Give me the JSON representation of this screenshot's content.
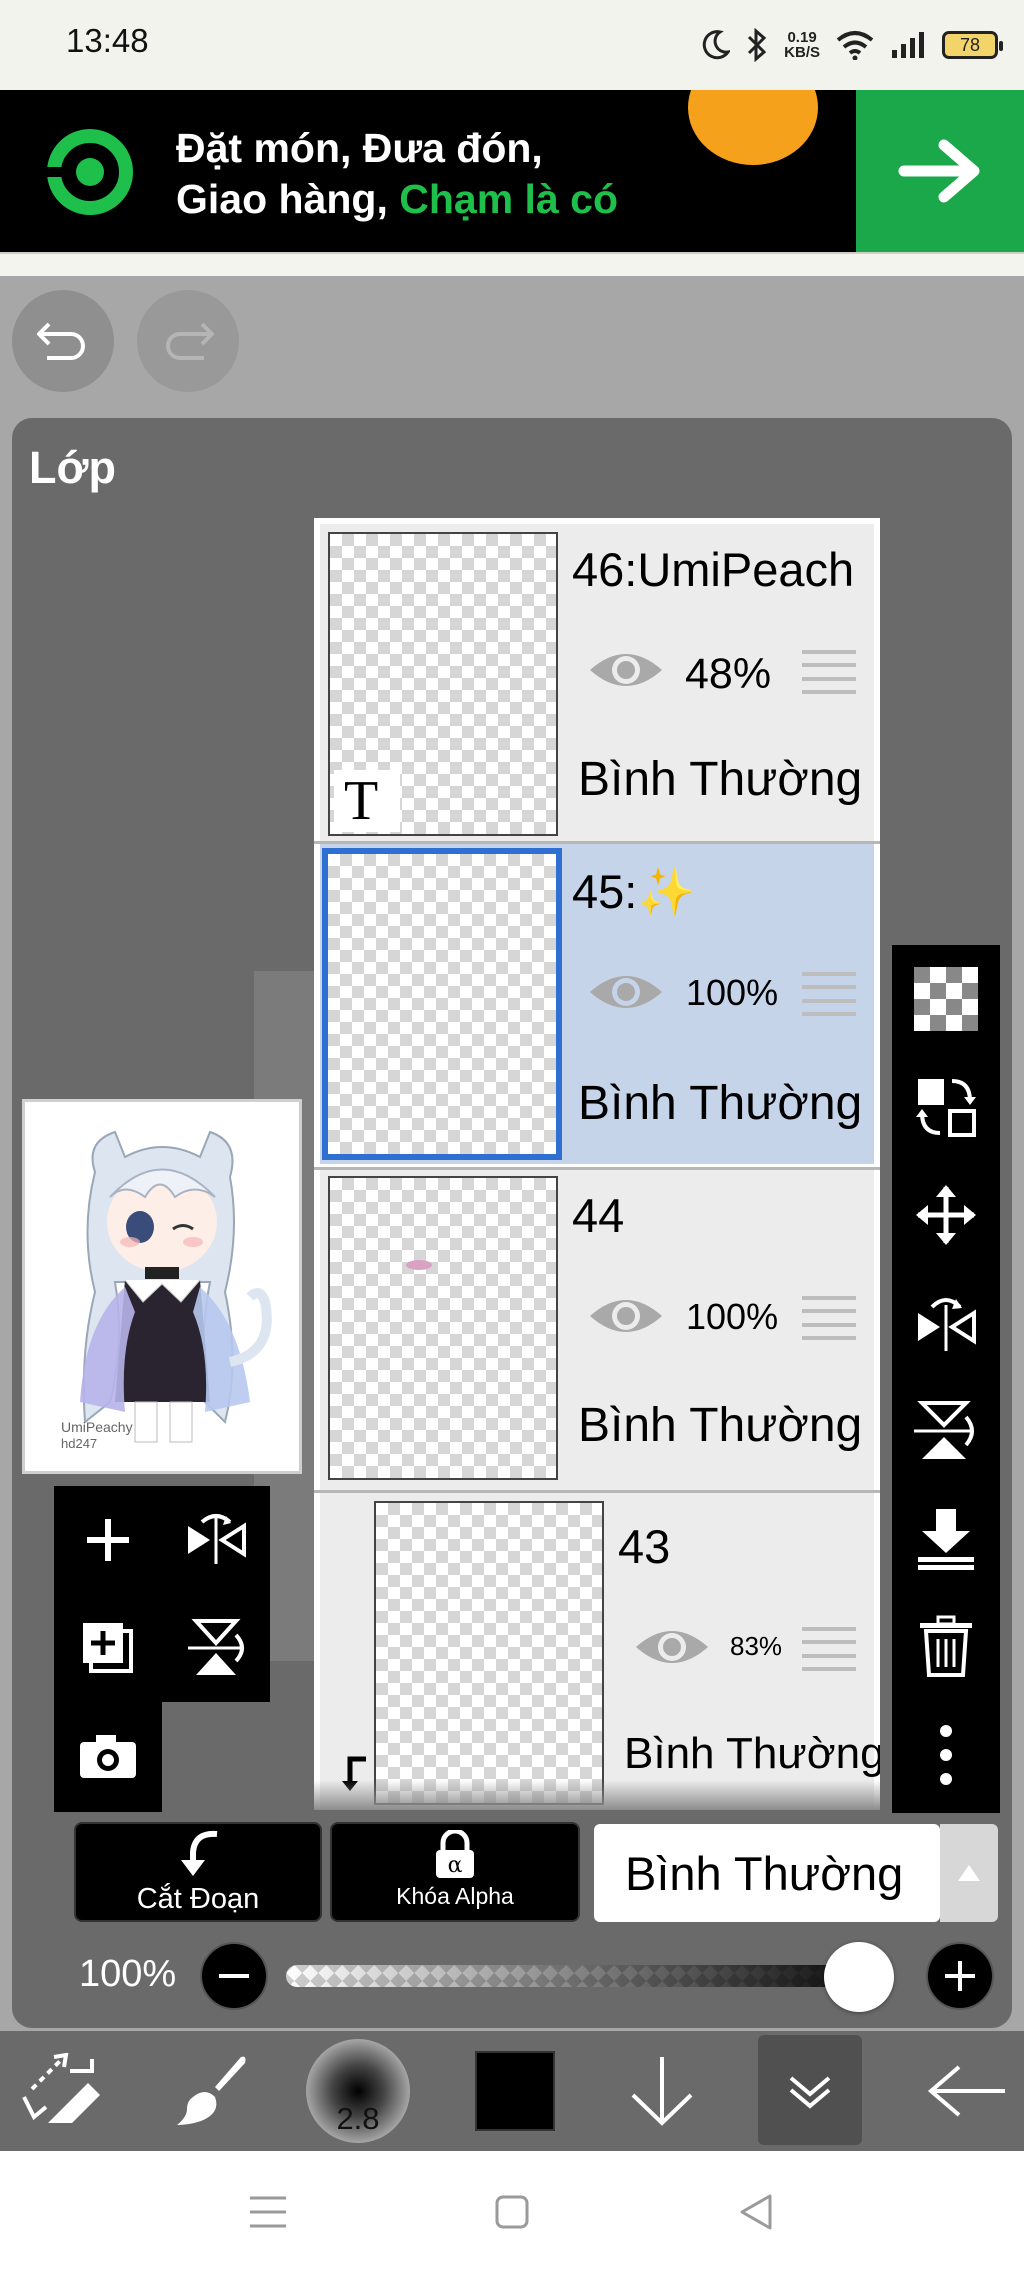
{
  "status_bar": {
    "time": "13:48",
    "speed_value": "0.19",
    "speed_unit": "KB/S",
    "battery": "78"
  },
  "ad": {
    "line1": "Đặt món, Đưa đón,",
    "line2_prefix": "Giao hàng, ",
    "line2_highlight": "Chạm là có",
    "accent_color": "#1aa84b"
  },
  "panel": {
    "title": "Lớp"
  },
  "layers": [
    {
      "name": "46:UmiPeach",
      "opacity": "48%",
      "blend": "Bình Thường",
      "selected": false,
      "type": "text"
    },
    {
      "name": "45:✨",
      "opacity": "100%",
      "blend": "Bình Thường",
      "selected": true
    },
    {
      "name": "44",
      "opacity": "100%",
      "blend": "Bình Thường",
      "selected": false
    },
    {
      "name": "43",
      "opacity": "83%",
      "blend": "Bình Thường",
      "selected": false,
      "clipped": true
    }
  ],
  "preview": {
    "watermark_line1": "UmiPeachy",
    "watermark_line2": "hd247"
  },
  "bottom": {
    "clip_label": "Cắt Đoạn",
    "alpha_lock_label": "Khóa Alpha",
    "blend_mode": "Bình Thường",
    "opacity_label": "100%",
    "opacity_value": 1.0
  },
  "toolbar": {
    "brush_size": "2.8"
  },
  "icons": {
    "selected_color": "#000000",
    "selection_color": "#2f6fd1"
  }
}
